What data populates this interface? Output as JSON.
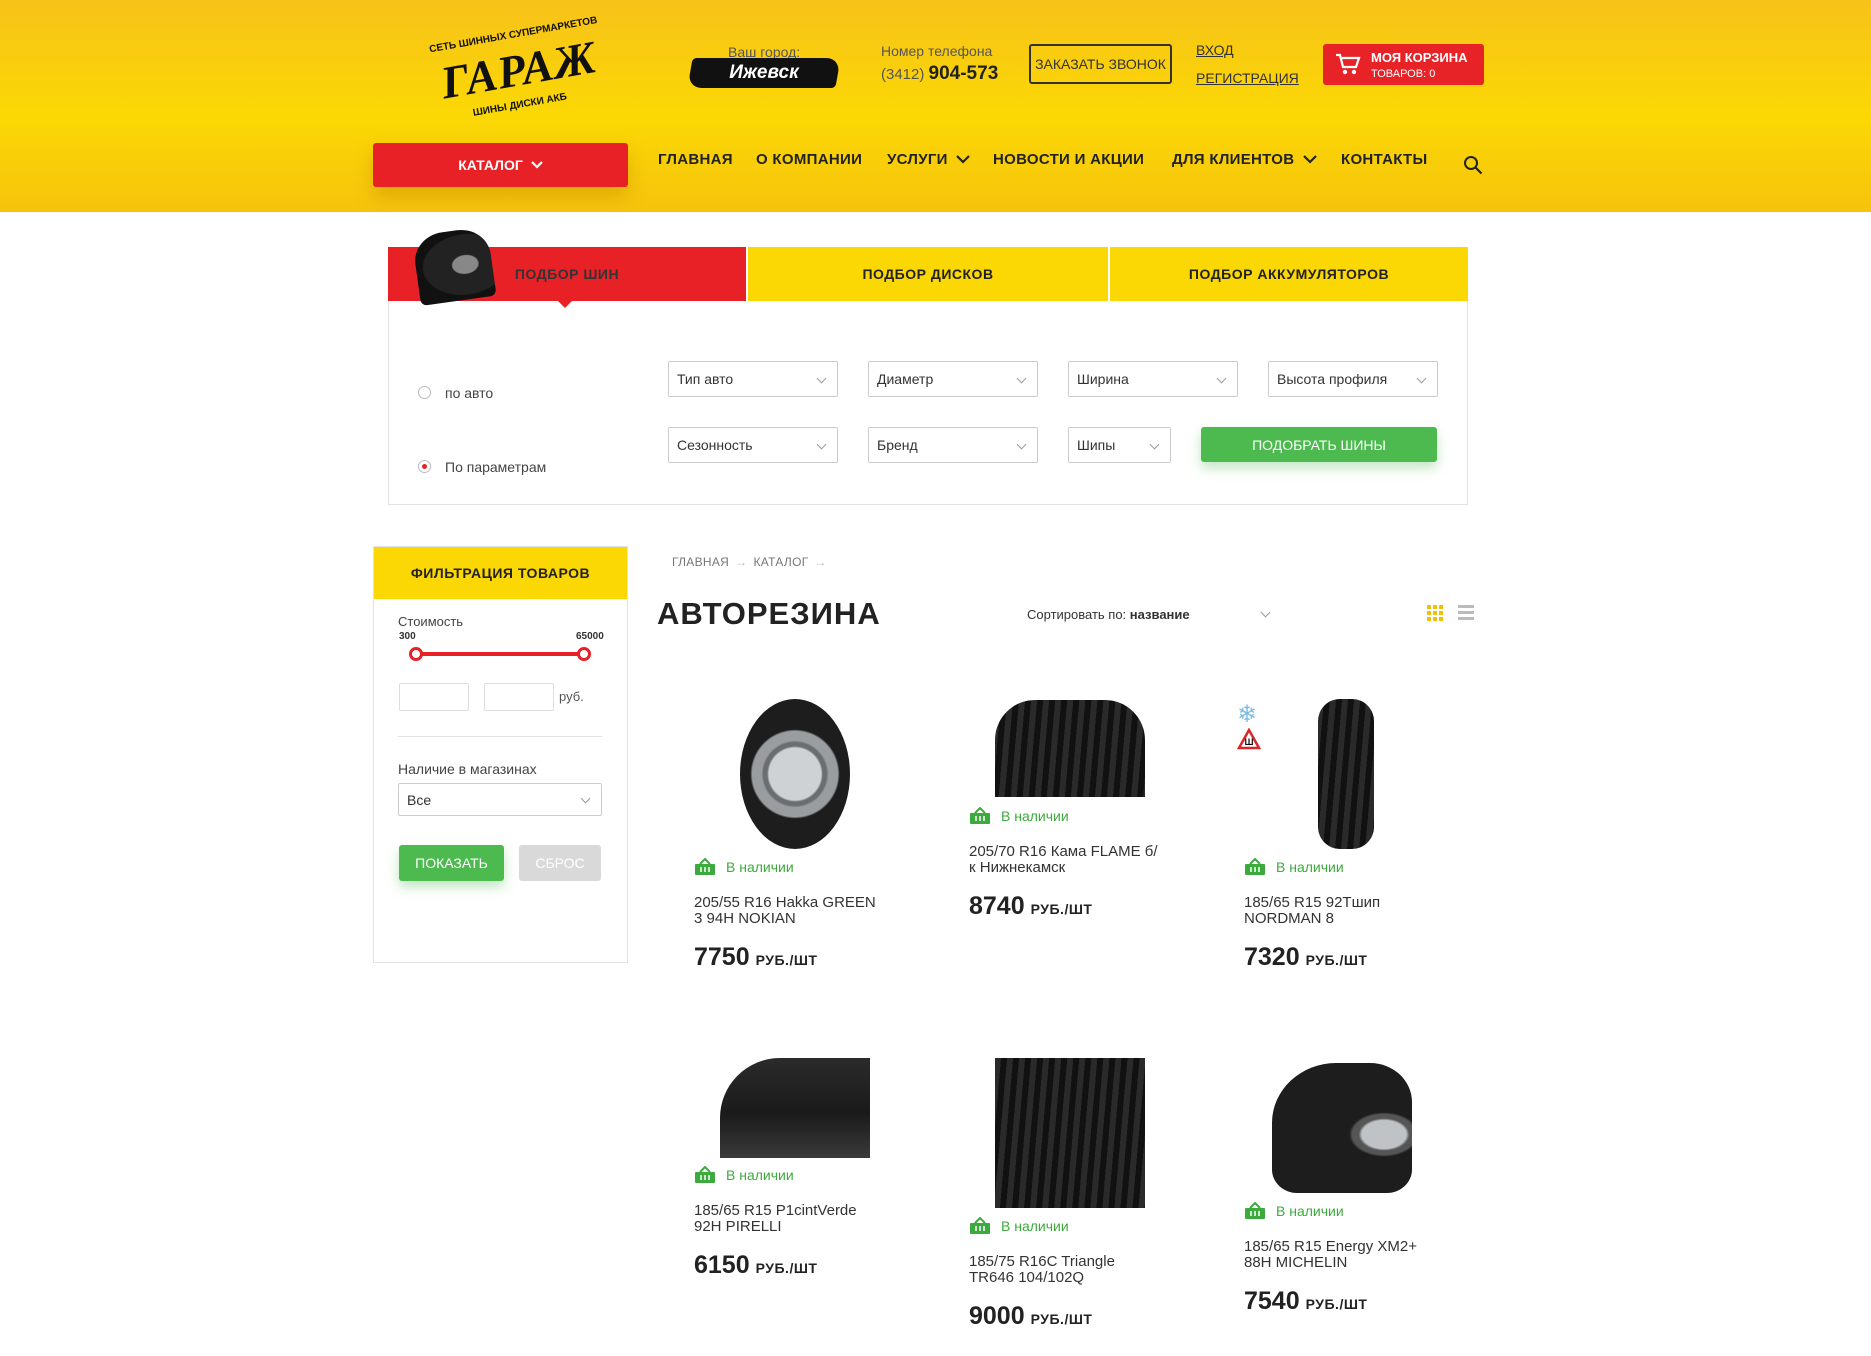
{
  "header": {
    "logo": {
      "top": "СЕТЬ ШИННЫХ СУПЕРМАРКЕТОВ",
      "main": "ГАРАЖ",
      "bottom": "ШИНЫ ДИСКИ АКБ"
    },
    "city_label": "Ваш город:",
    "city": "Ижевск",
    "phone_label": "Номер телефона",
    "phone_code": "(3412)",
    "phone_number": "904-573",
    "callback": "ЗАКАЗАТЬ ЗВОНОК",
    "login": "ВХОД",
    "register": "РЕГИСТРАЦИЯ",
    "cart_title": "МОЯ КОРЗИНА",
    "cart_count": "ТОВАРОВ: 0"
  },
  "nav": {
    "catalog": "КАТАЛОГ",
    "items": [
      "ГЛАВНАЯ",
      "О КОМПАНИИ",
      "УСЛУГИ",
      "НОВОСТИ И АКЦИИ",
      "ДЛЯ КЛИЕНТОВ",
      "КОНТАКТЫ"
    ]
  },
  "selector": {
    "tabs": [
      "ПОДБОР ШИН",
      "ПОДБОР ДИСКОВ",
      "ПОДБОР АККУМУЛЯТОРОВ"
    ],
    "radio_auto": "по авто",
    "radio_params": "По параметрам",
    "selects": [
      "Тип авто",
      "Диаметр",
      "Ширина",
      "Высота профиля",
      "Сезонность",
      "Бренд",
      "Шипы"
    ],
    "submit": "ПОДОБРАТЬ ШИНЫ"
  },
  "sidebar": {
    "title": "ФИЛЬТРАЦИЯ ТОВАРОВ",
    "price_label": "Стоимость",
    "min": "300",
    "max": "65000",
    "currency": "руб.",
    "availability_label": "Наличие в магазинах",
    "availability_value": "Все",
    "show": "ПОКАЗАТЬ",
    "reset": "СБРОС"
  },
  "content": {
    "breadcrumb": [
      "ГЛАВНАЯ",
      "КАТАЛОГ"
    ],
    "title": "АВТОРЕЗИНА",
    "sort_label": "Сортировать по:",
    "sort_value": "название"
  },
  "products": [
    {
      "availability": "В наличии",
      "name_line1": "205/55 R16 Hakka GREEN",
      "name_line2": "3 94H NOKIAN",
      "price": "7750",
      "unit": "РУБ./ШТ"
    },
    {
      "availability": "В наличии",
      "name_line1": "205/70 R16 Кама FLAME б/",
      "name_line2": "к Нижнекамск",
      "price": "8740",
      "unit": "РУБ./ШТ"
    },
    {
      "availability": "В наличии",
      "name_line1": "185/65 R15 92Тшип",
      "name_line2": "NORDMAN 8",
      "price": "7320",
      "unit": "РУБ./ШТ"
    },
    {
      "availability": "В наличии",
      "name_line1": "185/65 R15 P1cintVerde",
      "name_line2": "92H PIRELLI",
      "price": "6150",
      "unit": "РУБ./ШТ"
    },
    {
      "availability": "В наличии",
      "name_line1": "185/75 R16C Triangle",
      "name_line2": "TR646 104/102Q",
      "price": "9000",
      "unit": "РУБ./ШТ"
    },
    {
      "availability": "В наличии",
      "name_line1": "185/65 R15 Energy XM2+",
      "name_line2": "88H MICHELIN",
      "price": "7540",
      "unit": "РУБ./ШТ"
    }
  ]
}
